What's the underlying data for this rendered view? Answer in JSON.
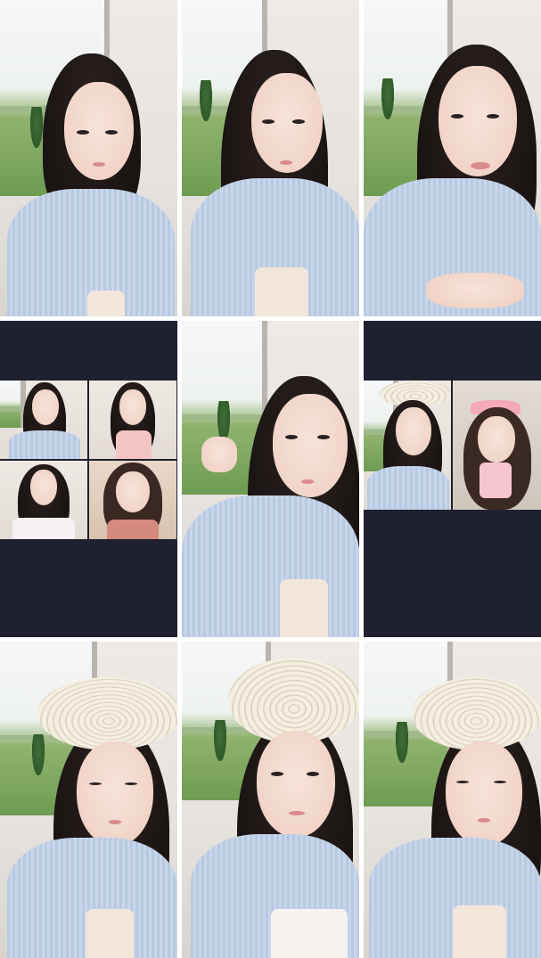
{
  "grid": {
    "rows": 3,
    "cols": 3,
    "tiles": [
      {
        "kind": "portrait",
        "hat": false
      },
      {
        "kind": "portrait",
        "hat": false
      },
      {
        "kind": "portrait",
        "hat": false
      },
      {
        "kind": "collage-4"
      },
      {
        "kind": "portrait",
        "hat": false
      },
      {
        "kind": "duo"
      },
      {
        "kind": "portrait",
        "hat": true
      },
      {
        "kind": "portrait",
        "hat": true
      },
      {
        "kind": "portrait",
        "hat": true
      }
    ]
  },
  "colors": {
    "pad": "#1f2130",
    "shirt": "#b8c9e2",
    "hair": "#1a1412",
    "grass": "#6f9b52",
    "hat": "#f4efe2"
  }
}
